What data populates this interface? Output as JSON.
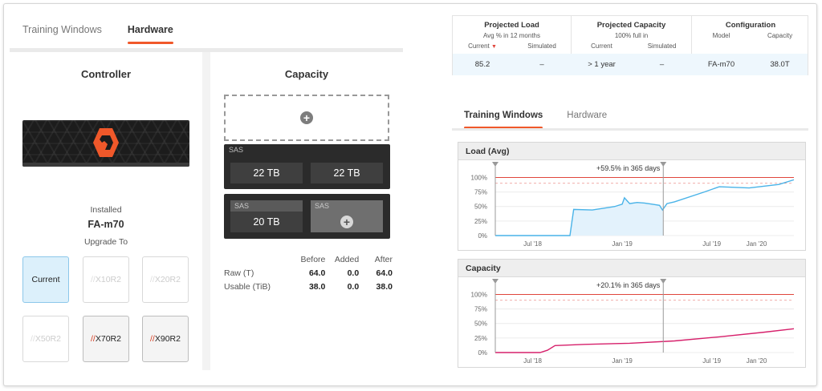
{
  "left_tabs": [
    {
      "label": "Training Windows"
    },
    {
      "label": "Hardware"
    }
  ],
  "controller": {
    "title": "Controller",
    "installed_label": "Installed",
    "installed_value": "FA-m70",
    "upgrade_label": "Upgrade To",
    "options": [
      {
        "label": "Current",
        "prefix": "",
        "state": "current"
      },
      {
        "label": "X10R2",
        "prefix": "//",
        "state": "disabled"
      },
      {
        "label": "X20R2",
        "prefix": "//",
        "state": "disabled"
      },
      {
        "label": "X50R2",
        "prefix": "//",
        "state": "disabled"
      },
      {
        "label": "X70R2",
        "prefix": "//",
        "state": "enabled"
      },
      {
        "label": "X90R2",
        "prefix": "//",
        "state": "enabled"
      }
    ]
  },
  "capacity": {
    "title": "Capacity",
    "shelf1": {
      "label": "SAS",
      "drives": [
        "22 TB",
        "22 TB"
      ]
    },
    "shelf2": {
      "drive_label": "SAS",
      "drive_value": "20 TB",
      "slot_label": "SAS"
    },
    "table": {
      "headers": [
        "Before",
        "Added",
        "After"
      ],
      "rows": [
        {
          "label": "Raw (T)",
          "values": [
            "64.0",
            "0.0",
            "64.0"
          ]
        },
        {
          "label": "Usable (TiB)",
          "values": [
            "38.0",
            "0.0",
            "38.0"
          ]
        }
      ]
    }
  },
  "projection": {
    "load": {
      "title": "Projected Load",
      "subtitle": "Avg % in 12 months",
      "current_label": "Current",
      "simulated_label": "Simulated",
      "current": "85.2",
      "simulated": "–"
    },
    "capacity": {
      "title": "Projected Capacity",
      "subtitle": "100% full in",
      "current_label": "Current",
      "simulated_label": "Simulated",
      "current": "> 1 year",
      "simulated": "–"
    },
    "configuration": {
      "title": "Configuration",
      "model_label": "Model",
      "capacity_label": "Capacity",
      "model": "FA-m70",
      "capacity": "38.0T"
    }
  },
  "right_tabs": [
    {
      "label": "Training Windows"
    },
    {
      "label": "Hardware"
    }
  ],
  "colors": {
    "accent": "#f0582a",
    "load_line": "#49b3e8",
    "load_fill": "#e3f2fc",
    "capacity_line": "#d6206b",
    "threshold": "#e0463c"
  },
  "chart_data": [
    {
      "type": "area",
      "title": "Load (Avg)",
      "annotation": "+59.5% in 365 days",
      "y_ticks": [
        "100%",
        "75%",
        "50%",
        "25%",
        "0%"
      ],
      "x_ticks": [
        "Jul '18",
        "Jan '19",
        "Jul '19",
        "Jan '20"
      ],
      "ylim": [
        0,
        100
      ],
      "threshold": 100,
      "warning": 90,
      "series": [
        {
          "x": [
            0,
            9,
            10,
            10.5,
            13,
            16,
            17,
            17.3,
            18,
            19,
            20,
            21,
            22,
            22.4,
            23,
            24,
            28,
            30,
            34,
            38,
            40
          ],
          "values": [
            0,
            0,
            0,
            45,
            44,
            50,
            54,
            65,
            55,
            57,
            56,
            54,
            52,
            44,
            55,
            58,
            75,
            84,
            82,
            88,
            96
          ]
        }
      ]
    },
    {
      "type": "line",
      "title": "Capacity",
      "annotation": "+20.1% in 365 days",
      "y_ticks": [
        "100%",
        "75%",
        "50%",
        "25%",
        "0%"
      ],
      "x_ticks": [
        "Jul '18",
        "Jan '19",
        "Jul '19",
        "Jan '20"
      ],
      "ylim": [
        0,
        100
      ],
      "threshold": 100,
      "warning": 90,
      "series": [
        {
          "x": [
            0,
            6,
            7,
            8,
            12,
            18,
            24,
            30,
            36,
            40
          ],
          "values": [
            0,
            0,
            4,
            12,
            14,
            16,
            20,
            27,
            35,
            41
          ]
        }
      ]
    }
  ]
}
